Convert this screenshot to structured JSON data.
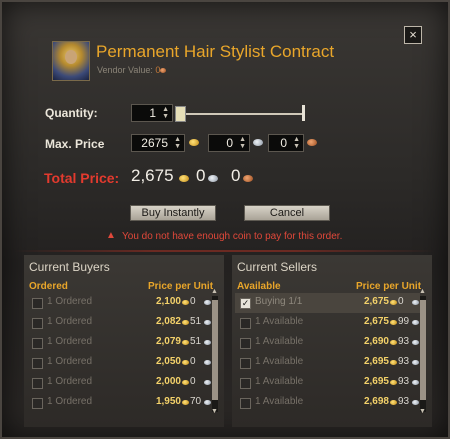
{
  "dialog": {
    "item_name": "Permanent Hair Stylist Contract",
    "vendor_value_label": "Vendor Value:",
    "vendor_value_copper": "0",
    "close_label": "×"
  },
  "form": {
    "quantity_label": "Quantity:",
    "quantity": "1",
    "max_price_label": "Max. Price",
    "max_gold": "2675",
    "max_silver": "0",
    "max_copper": "0",
    "total_label": "Total Price:",
    "total_gold": "2,675",
    "total_silver": "0",
    "total_copper": "0",
    "buy_button": "Buy Instantly",
    "cancel_button": "Cancel",
    "warning": "You do not have enough coin to pay for this order."
  },
  "buyers": {
    "title": "Current Buyers",
    "col_ordered": "Ordered",
    "col_price": "Price per Unit",
    "rows": [
      {
        "ordered": "1 Ordered",
        "gold": "2,100",
        "silver": "0"
      },
      {
        "ordered": "1 Ordered",
        "gold": "2,082",
        "silver": "51"
      },
      {
        "ordered": "1 Ordered",
        "gold": "2,079",
        "silver": "51"
      },
      {
        "ordered": "1 Ordered",
        "gold": "2,050",
        "silver": "0"
      },
      {
        "ordered": "1 Ordered",
        "gold": "2,000",
        "silver": "0"
      },
      {
        "ordered": "1 Ordered",
        "gold": "1,950",
        "silver": "70"
      }
    ]
  },
  "sellers": {
    "title": "Current Sellers",
    "col_available": "Available",
    "col_price": "Price per Unit",
    "rows": [
      {
        "available": "Buying 1/1",
        "gold": "2,675",
        "silver": "0",
        "checked": true
      },
      {
        "available": "1 Available",
        "gold": "2,675",
        "silver": "99"
      },
      {
        "available": "1 Available",
        "gold": "2,690",
        "silver": "93"
      },
      {
        "available": "1 Available",
        "gold": "2,695",
        "silver": "93"
      },
      {
        "available": "1 Available",
        "gold": "2,695",
        "silver": "93"
      },
      {
        "available": "1 Available",
        "gold": "2,698",
        "silver": "93"
      }
    ]
  },
  "colors": {
    "accent": "#e9a62a",
    "warning": "#e0483a",
    "gold_text": "#f4d26a"
  }
}
